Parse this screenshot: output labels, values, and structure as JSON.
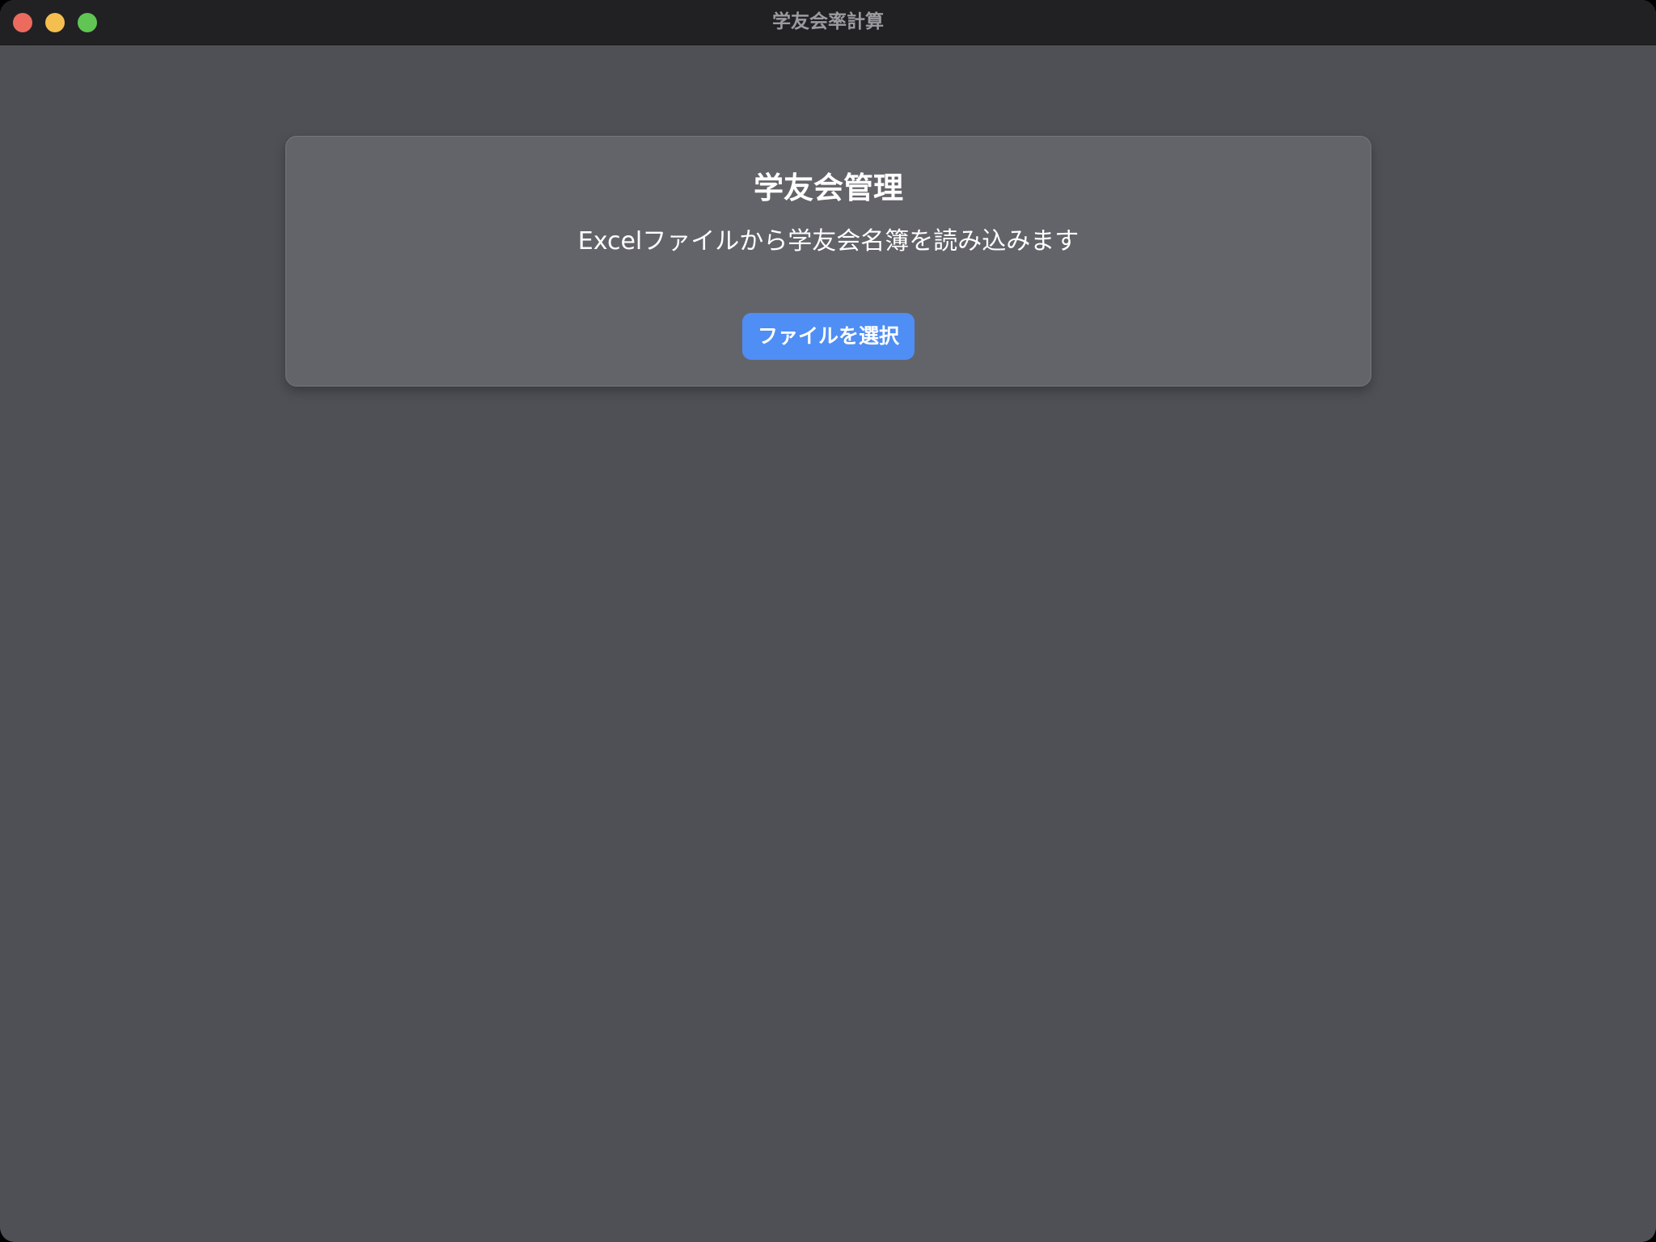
{
  "window": {
    "title": "学友会率計算"
  },
  "card": {
    "title": "学友会管理",
    "subtitle": "Excelファイルから学友会名簿を読み込みます",
    "select_button_label": "ファイルを選択"
  },
  "colors": {
    "window_background": "#4f5056",
    "titlebar": "#212123",
    "card_background": "#636469",
    "accent_button": "#4f8ef4",
    "close": "#ec6a5e",
    "minimize": "#f4bf4f",
    "zoom": "#61c554"
  }
}
